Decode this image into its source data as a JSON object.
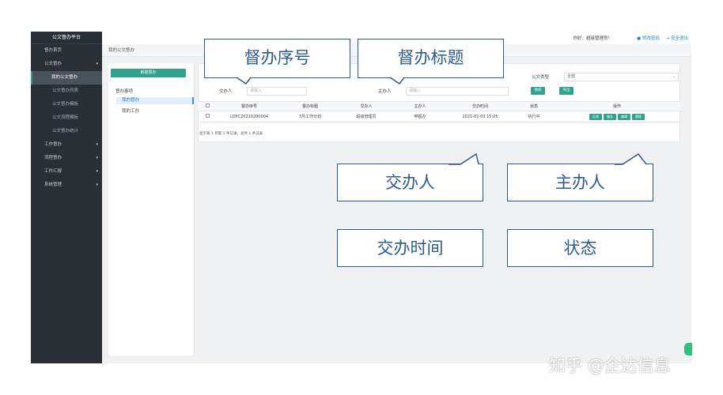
{
  "sidebar": {
    "brand": "公文督办平台",
    "items": [
      {
        "label": "督办首页"
      },
      {
        "label": "公文督办",
        "caret": "▾"
      },
      {
        "label": "我的公文督办"
      },
      {
        "label": "公文督办列表"
      },
      {
        "label": "公文督办模板"
      },
      {
        "label": "公文流程模板"
      },
      {
        "label": "公文督办统计"
      },
      {
        "label": "工作督办",
        "caret": "▾"
      },
      {
        "label": "流程督办",
        "caret": "▾"
      },
      {
        "label": "工作汇报",
        "caret": "▾"
      },
      {
        "label": "系统管理",
        "caret": "▾"
      }
    ]
  },
  "header": {
    "greeting": "你好，超级管理员！",
    "change_password": "修改密码",
    "logout": "安全退出"
  },
  "breadcrumb": "我的公文督办",
  "left_panel": {
    "new_button": "新建督办",
    "tree_root": "督办事项",
    "tree_selected": "我的督办",
    "tree_child": "我的工办"
  },
  "search": {
    "assigner_label": "交办人",
    "assigner_placeholder": "请输入",
    "host_label": "主办人",
    "host_placeholder": "请输入",
    "category_label": "公文类型",
    "category_value": "全部",
    "search_button": "搜索",
    "export_button": "导出"
  },
  "table": {
    "headers": [
      "",
      "督办序号",
      "督办标题",
      "交办人",
      "主办人",
      "交办时间",
      "状态",
      "操作"
    ],
    "rows": [
      {
        "seq": "LDPC20210200004",
        "title": "3月工作计划",
        "assigner": "超级管理员",
        "host": "申超办",
        "time": "2021-02-03 15:05",
        "status": "执行中"
      }
    ],
    "ops": [
      "反馈",
      "催办",
      "编辑",
      "删除"
    ]
  },
  "pager": "显示第 1 到第 1 条记录，总共 1 条记录",
  "callouts": {
    "seq": "督办序号",
    "title": "督办标题",
    "assigner": "交办人",
    "host": "主办人",
    "time": "交办时间",
    "status": "状态"
  },
  "watermark": "知乎 @企达信息",
  "colors": {
    "accent": "#2fa38e",
    "sidebar": "#2a2f36",
    "callout": "#2d5b8a"
  }
}
